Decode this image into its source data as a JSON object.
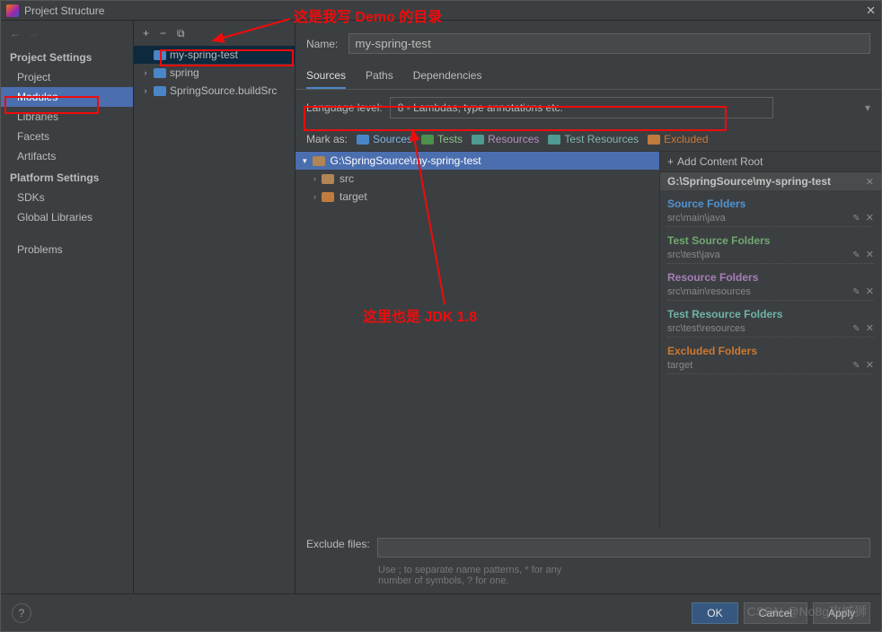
{
  "window": {
    "title": "Project Structure"
  },
  "annotations": {
    "top": "这是我写 Demo 的目录",
    "bottom": "这里也是 JDK 1.8"
  },
  "navArrows": {
    "back": "←",
    "fwd": "→"
  },
  "sidebar": {
    "section1": "Project Settings",
    "items1": [
      "Project",
      "Modules",
      "Libraries",
      "Facets",
      "Artifacts"
    ],
    "section2": "Platform Settings",
    "items2": [
      "SDKs",
      "Global Libraries"
    ],
    "section3_item": "Problems"
  },
  "midToolbar": {
    "add": "+",
    "remove": "−",
    "copy": "⧉"
  },
  "moduleTree": [
    {
      "label": "my-spring-test",
      "selected": true
    },
    {
      "label": "spring"
    },
    {
      "label": "SpringSource.buildSrc"
    }
  ],
  "form": {
    "nameLabel": "Name:",
    "nameValue": "my-spring-test",
    "tabs": [
      "Sources",
      "Paths",
      "Dependencies"
    ],
    "langLabel": "Language level:",
    "langValue": "8 - Lambdas, type annotations etc.",
    "markLabel": "Mark as:",
    "marks": [
      {
        "label": "Sources",
        "cls": "folder-blue"
      },
      {
        "label": "Tests",
        "cls": "folder-green"
      },
      {
        "label": "Resources",
        "cls": "folder-teal"
      },
      {
        "label": "Test Resources",
        "cls": "folder-teal"
      },
      {
        "label": "Excluded",
        "cls": "folder-orange"
      }
    ]
  },
  "srcTree": {
    "root": "G:\\SpringSource\\my-spring-test",
    "children": [
      "src",
      "target"
    ]
  },
  "roots": {
    "addLabel": "Add Content Root",
    "title": "G:\\SpringSource\\my-spring-test",
    "sections": [
      {
        "hdr": "Source Folders",
        "cls": "c-blue",
        "val": "src\\main\\java"
      },
      {
        "hdr": "Test Source Folders",
        "cls": "c-green",
        "val": "src\\test\\java"
      },
      {
        "hdr": "Resource Folders",
        "cls": "c-purple",
        "val": "src\\main\\resources"
      },
      {
        "hdr": "Test Resource Folders",
        "cls": "c-teal",
        "val": "src\\test\\resources"
      },
      {
        "hdr": "Excluded Folders",
        "cls": "c-orange",
        "val": "target"
      }
    ]
  },
  "exclude": {
    "label": "Exclude files:",
    "hint1": "Use ; to separate name patterns, * for any",
    "hint2": "number of symbols, ? for one."
  },
  "buttons": {
    "ok": "OK",
    "cancel": "Cancel",
    "apply": "Apply",
    "help": "?"
  },
  "watermark": "CSDN @No8g攻城狮"
}
